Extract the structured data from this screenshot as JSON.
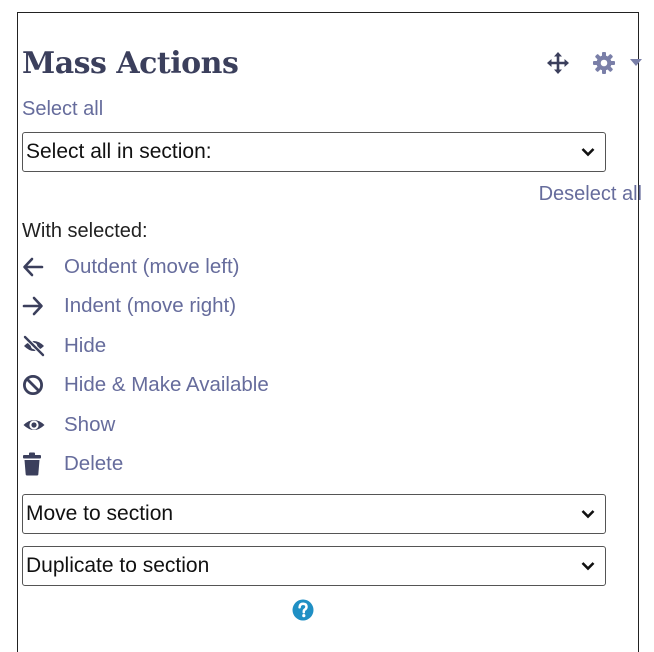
{
  "block": {
    "title": "Mass Actions",
    "move_icon": "arrows-move-icon",
    "settings_icon": "gear-icon",
    "dropdown_icon": "caret-down-icon"
  },
  "select_all_link": "Select all",
  "section_select": {
    "selected": "Select all in section:"
  },
  "deselect_all_link": "Deselect all",
  "with_selected_label": "With selected:",
  "actions": [
    {
      "label": "Outdent (move left)",
      "icon": "arrow-left-icon"
    },
    {
      "label": "Indent (move right)",
      "icon": "arrow-right-icon"
    },
    {
      "label": "Hide",
      "icon": "eye-slash-icon"
    },
    {
      "label": "Hide & Make Available",
      "icon": "ban-icon"
    },
    {
      "label": "Show",
      "icon": "eye-icon"
    },
    {
      "label": "Delete",
      "icon": "trash-icon"
    }
  ],
  "move_select": {
    "selected": "Move to section"
  },
  "duplicate_select": {
    "selected": "Duplicate to section"
  },
  "help_icon": "question-circle-icon",
  "colors": {
    "link": "#666c9c",
    "title": "#3b3f5c",
    "help": "#1f8fc4",
    "icon": "#3b3f5c"
  }
}
